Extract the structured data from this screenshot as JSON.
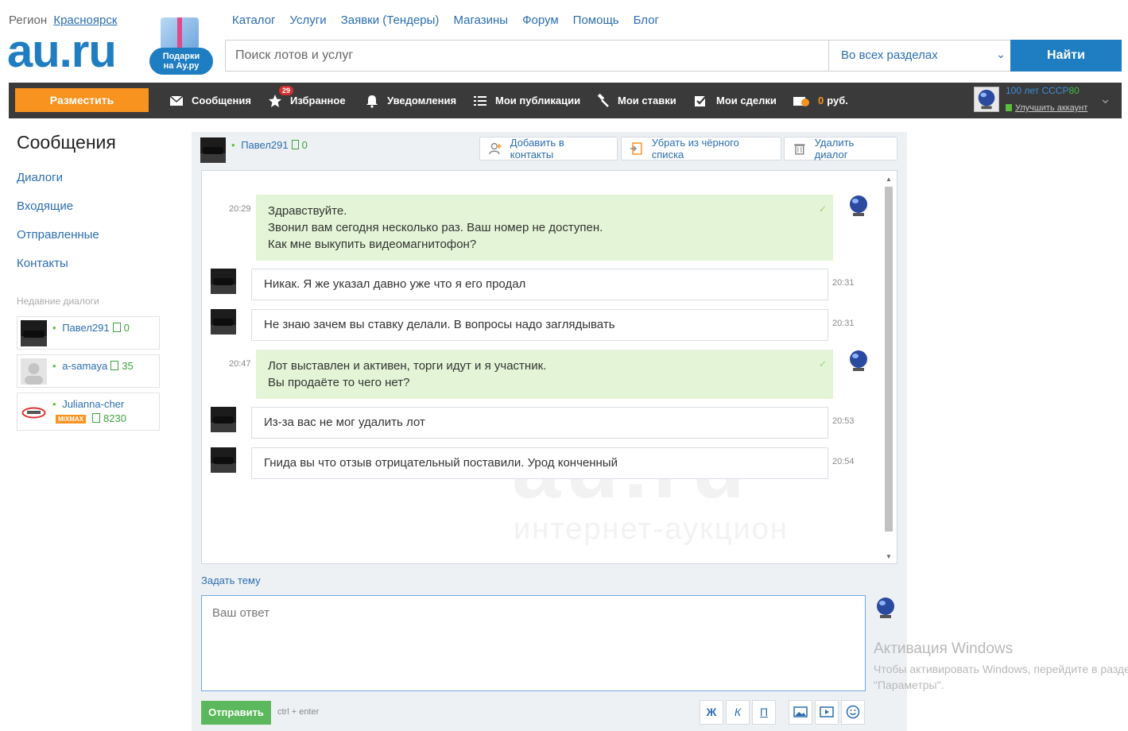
{
  "header": {
    "region_label": "Регион",
    "region_city": "Красноярск",
    "logo": "au.ru",
    "gift_badge_line1": "Подарки",
    "gift_badge_line2": "на Ау.ру",
    "nav": [
      "Каталог",
      "Услуги",
      "Заявки (Тендеры)",
      "Магазины",
      "Форум",
      "Помощь",
      "Блог"
    ],
    "search_placeholder": "Поиск лотов и услуг",
    "section_select": "Во всех разделах",
    "find_button": "Найти"
  },
  "toolbar": {
    "place_button": "Разместить",
    "items": {
      "messages": "Сообщения",
      "favorites": "Избранное",
      "favorites_badge": "29",
      "notifications": "Уведомления",
      "publications": "Мои публикации",
      "bids": "Мои ставки",
      "deals": "Мои сделки",
      "balance_amount": "0",
      "balance_currency": "руб."
    },
    "user": {
      "name": "100 лет СССР",
      "rating": "80",
      "upgrade": "Улучшить аккаунт"
    }
  },
  "sidebar": {
    "title": "Сообщения",
    "links": [
      "Диалоги",
      "Входящие",
      "Отправленные",
      "Контакты"
    ],
    "recent_title": "Недавние диалоги",
    "recent": [
      {
        "name": "Павел291",
        "rating": "0"
      },
      {
        "name": "a-samaya",
        "rating": "35"
      },
      {
        "name": "Julianna-cher",
        "badge": "MIXMAX",
        "rating": "8230"
      }
    ]
  },
  "dialog": {
    "partner_name": "Павел291",
    "partner_rating": "0",
    "add_contact": "Добавить в контакты",
    "remove_blacklist": "Убрать из чёрного списка",
    "delete_dialog": "Удалить диалог",
    "messages": [
      {
        "dir": "out",
        "time": "20:29",
        "lines": [
          "Здравствуйте.",
          "Звонил вам сегодня несколько раз. Ваш номер не доступен.",
          "Как мне выкупить видеомагнитофон?"
        ]
      },
      {
        "dir": "in",
        "time": "20:31",
        "lines": [
          "Никак. Я же указал давно уже что я его продал"
        ]
      },
      {
        "dir": "in",
        "time": "20:31",
        "lines": [
          "Не знаю зачем вы ставку делали. В вопросы надо заглядывать"
        ]
      },
      {
        "dir": "out",
        "time": "20:47",
        "lines": [
          "Лот выставлен и активен, торги идут и я участник.",
          "Вы продаёте то чего нет?"
        ]
      },
      {
        "dir": "in",
        "time": "20:53",
        "lines": [
          "Из-за вас не мог удалить лот"
        ]
      },
      {
        "dir": "in",
        "time": "20:54",
        "lines": [
          "Гнида вы что отзыв отрицательный поставили. Урод конченный"
        ]
      }
    ],
    "watermark": "au.ru",
    "watermark_sub": "интернет-аукцион",
    "subject_link": "Задать тему",
    "reply_placeholder": "Ваш ответ",
    "send_button": "Отправить",
    "send_hint": "ctrl + enter",
    "format": {
      "bold": "Ж",
      "italic": "К",
      "underline": "П"
    }
  },
  "windows_activation": {
    "title": "Активация Windows",
    "line1": "Чтобы активировать Windows, перейдите в раздел",
    "line2": "\"Параметры\"."
  },
  "colors": {
    "brand": "#1f7dc1",
    "accent": "#f7931e",
    "out_bubble": "#e3f5d6",
    "send": "#5cb85c"
  }
}
